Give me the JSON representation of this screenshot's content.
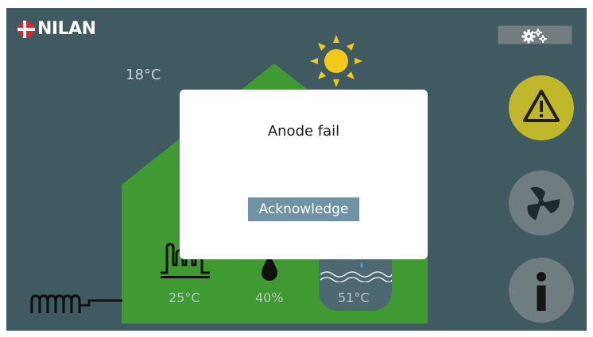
{
  "brand": {
    "name": "NILAN"
  },
  "outdoor": {
    "temperature": "18°C"
  },
  "readouts": {
    "heating_temp": "25°C",
    "humidity": "40%",
    "water_temp": "51°C"
  },
  "dialog": {
    "message": "Anode fail",
    "button_label": "Acknowledge"
  },
  "icons": {
    "settings": "gears-icon",
    "weather": "sun-icon",
    "alarm": "warning-triangle-icon",
    "fan": "fan-icon",
    "info": "info-icon",
    "heater": "floor-heating-icon",
    "humidity": "water-drop-icon",
    "water": "water-tank-icon",
    "radiator": "radiator-icon"
  },
  "colors": {
    "background": "#3f5a61",
    "house": "#3f9a32",
    "alarm": "#c0b82a",
    "sun": "#f2c81a",
    "dialog": "#ffffff",
    "button": "#6f93a3"
  }
}
